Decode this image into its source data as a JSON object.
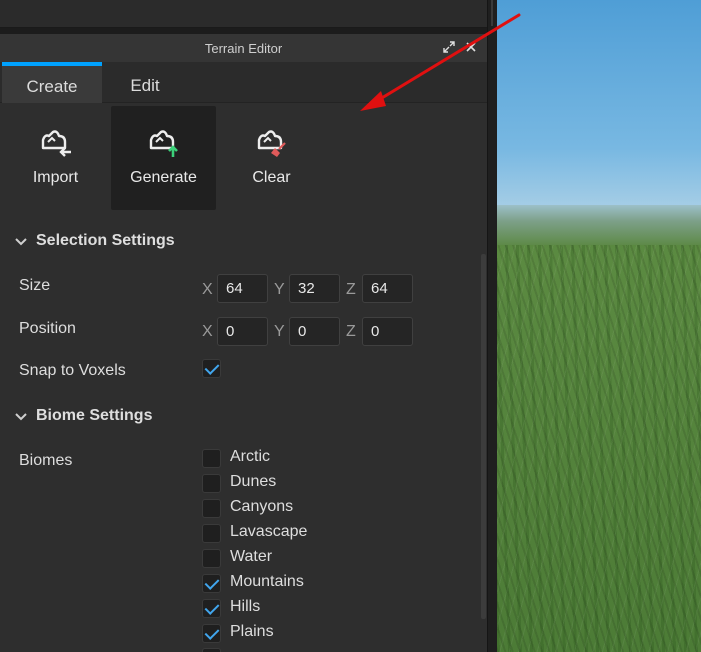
{
  "panel": {
    "title": "Terrain Editor"
  },
  "tabs": [
    {
      "label": "Create",
      "active": true
    },
    {
      "label": "Edit",
      "active": false
    }
  ],
  "tools": [
    {
      "label": "Import",
      "icon": "terrain-import-icon"
    },
    {
      "label": "Generate",
      "icon": "terrain-generate-icon",
      "selected": true
    },
    {
      "label": "Clear",
      "icon": "terrain-clear-icon"
    }
  ],
  "selection": {
    "header": "Selection Settings",
    "size": {
      "label": "Size",
      "x": "64",
      "y": "32",
      "z": "64"
    },
    "position": {
      "label": "Position",
      "x": "0",
      "y": "0",
      "z": "0"
    },
    "snap": {
      "label": "Snap to Voxels",
      "checked": true
    },
    "axis": {
      "x": "X",
      "y": "Y",
      "z": "Z"
    }
  },
  "biome": {
    "header": "Biome Settings",
    "label": "Biomes",
    "items": [
      {
        "name": "Arctic",
        "checked": false
      },
      {
        "name": "Dunes",
        "checked": false
      },
      {
        "name": "Canyons",
        "checked": false
      },
      {
        "name": "Lavascape",
        "checked": false
      },
      {
        "name": "Water",
        "checked": false
      },
      {
        "name": "Mountains",
        "checked": true
      },
      {
        "name": "Hills",
        "checked": true
      },
      {
        "name": "Plains",
        "checked": true
      }
    ]
  },
  "colors": {
    "accent": "#00a2ff",
    "check": "#41a6ee",
    "annotation": "#e01010"
  }
}
